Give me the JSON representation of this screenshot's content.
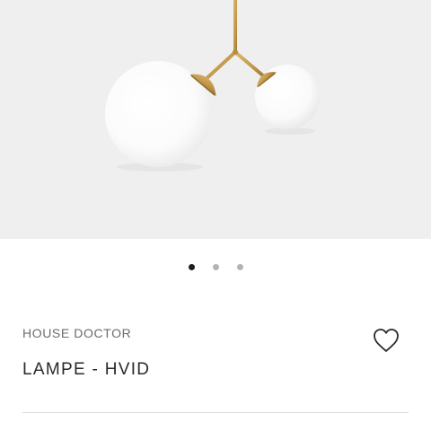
{
  "product_image": {
    "icon": "pendant-lamp-image",
    "background_color": "#efefef",
    "brass_color": "#c49a4c",
    "glass_color": "#ffffff"
  },
  "carousel": {
    "total": 3,
    "active_index": 0,
    "active_color": "#1e1e1e",
    "inactive_color": "#b3b3b3"
  },
  "product": {
    "brand": "HOUSE DOCTOR",
    "title": "LAMPE - HVID"
  },
  "favorite": {
    "icon": "heart-icon"
  }
}
